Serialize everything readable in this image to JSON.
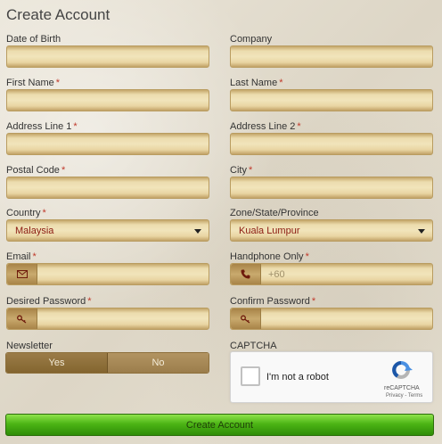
{
  "title": "Create Account",
  "fields": {
    "dob": {
      "label": "Date of Birth",
      "required": ""
    },
    "company": {
      "label": "Company",
      "required": ""
    },
    "first_name": {
      "label": "First Name",
      "required": "*"
    },
    "last_name": {
      "label": "Last Name",
      "required": "*"
    },
    "address1": {
      "label": "Address Line 1",
      "required": "*"
    },
    "address2": {
      "label": "Address Line 2",
      "required": "*"
    },
    "postal_code": {
      "label": "Postal Code",
      "required": "*"
    },
    "city": {
      "label": "City",
      "required": "*"
    },
    "country": {
      "label": "Country",
      "required": "*",
      "value": "Malaysia"
    },
    "zone": {
      "label": "Zone/State/Province",
      "required": "",
      "value": "Kuala Lumpur"
    },
    "email": {
      "label": "Email",
      "required": "*"
    },
    "handphone": {
      "label": "Handphone Only",
      "required": "*",
      "placeholder": "+60"
    },
    "password": {
      "label": "Desired Password",
      "required": "*"
    },
    "confirm_password": {
      "label": "Confirm Password",
      "required": "*"
    }
  },
  "newsletter": {
    "label": "Newsletter",
    "yes": "Yes",
    "no": "No"
  },
  "captcha": {
    "label": "CAPTCHA",
    "checkbox_text": "I'm not a robot",
    "brand": "reCAPTCHA",
    "terms": "Privacy - Terms"
  },
  "submit_label": "Create Account",
  "colors": {
    "field": "#ecdcae",
    "select_text": "#8b1a10",
    "submit": "#4cb515",
    "required": "#c0392b"
  },
  "icons": {
    "email": "envelope-icon",
    "phone": "phone-icon",
    "password": "key-icon",
    "select": "chevron-down-icon",
    "captcha": "recaptcha-logo-icon"
  }
}
